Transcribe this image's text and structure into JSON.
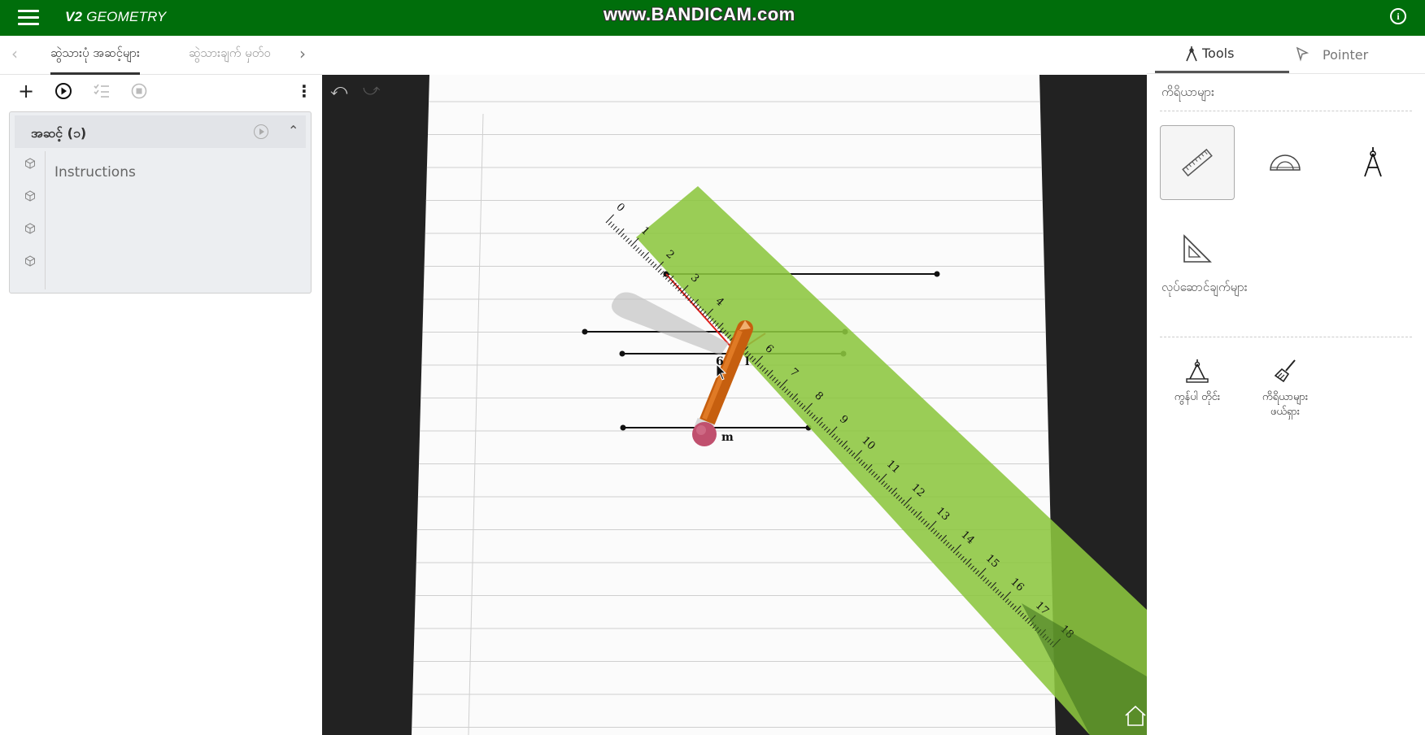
{
  "header": {
    "brand_bold": "V2",
    "brand_rest": "GEOMETRY",
    "watermark": "www.BANDICAM.com",
    "info_label": "i"
  },
  "left_tabs": {
    "prev_arrow": "‹",
    "next_arrow": "›",
    "tab1": "ဆွဲသားပုံ အဆင့်များ",
    "tab2": "ဆွဲသားချက် မှတ်ဝ"
  },
  "toolbar": {
    "add_label": "+",
    "more_label": "⋮"
  },
  "step": {
    "title": "အဆင့် (၁)",
    "collapse": "⌃",
    "instructions": "Instructions"
  },
  "canvas": {
    "undo": "⤺",
    "redo": "⤻",
    "ruler_ticks": [
      "0",
      "1",
      "2",
      "3",
      "4",
      "5",
      "6",
      "7",
      "8",
      "9",
      "10",
      "11",
      "12",
      "13",
      "14",
      "15",
      "16",
      "17",
      "18"
    ],
    "point_labels": [
      "6",
      "l",
      "m"
    ]
  },
  "right_panel": {
    "tab_tools": "Tools",
    "tab_pointer": "Pointer",
    "instruments_title": "ကိရိယာများ",
    "actions_title": "လုပ်ဆောင်ချက်များ",
    "action_snap": "ကွန်ပါ တိုင်း",
    "action_clear_line1": "ကိရိယာများ",
    "action_clear_line2": "ဖယ်ရှား"
  },
  "colors": {
    "topbar": "#006e0b",
    "ruler": "#8cc63f",
    "pencil": "#d2691e",
    "eraser": "#c0506e"
  }
}
